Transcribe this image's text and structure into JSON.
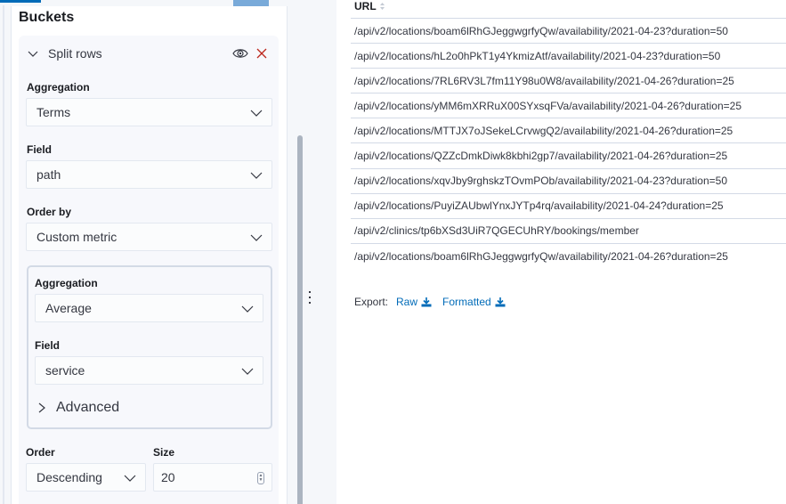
{
  "editor": {
    "section_title": "Buckets",
    "split": {
      "title": "Split rows",
      "toggle_icon": "chevron-down-icon",
      "visibility_icon": "eye-icon",
      "remove_icon": "close-icon"
    },
    "aggregation": {
      "label": "Aggregation",
      "value": "Terms"
    },
    "field": {
      "label": "Field",
      "value": "path"
    },
    "order_by": {
      "label": "Order by",
      "value": "Custom metric"
    },
    "custom_metric": {
      "aggregation": {
        "label": "Aggregation",
        "value": "Average"
      },
      "field": {
        "label": "Field",
        "value": "service"
      },
      "advanced_label": "Advanced"
    },
    "order": {
      "label": "Order",
      "value": "Descending"
    },
    "size": {
      "label": "Size",
      "value": "20"
    }
  },
  "table": {
    "column_header": "URL",
    "rows": [
      "/api/v2/locations/boam6lRhGJeggwgrfyQw/availability/2021-04-23?duration=50",
      "/api/v2/locations/hL2o0hPkT1y4YkmizAtf/availability/2021-04-23?duration=50",
      "/api/v2/locations/7RL6RV3L7fm11Y98u0W8/availability/2021-04-26?duration=25",
      "/api/v2/locations/yMM6mXRRuX00SYxsqFVa/availability/2021-04-26?duration=25",
      "/api/v2/locations/MTTJX7oJSekeLCrvwgQ2/availability/2021-04-26?duration=25",
      "/api/v2/locations/QZZcDmkDiwk8kbhi2gp7/availability/2021-04-26?duration=25",
      "/api/v2/locations/xqvJby9rghskzTOvmPOb/availability/2021-04-23?duration=50",
      "/api/v2/locations/PuyiZAUbwlYnxJYTp4rq/availability/2021-04-24?duration=25",
      "/api/v2/clinics/tp6bXSd3UiR7QGECUhRY/bookings/member",
      "/api/v2/locations/boam6lRhGJeggwgrfyQw/availability/2021-04-26?duration=25"
    ]
  },
  "export": {
    "label": "Export:",
    "raw": "Raw",
    "formatted": "Formatted"
  },
  "colors": {
    "link": "#006bb8",
    "danger": "#bd271e",
    "accent": "#006bb8"
  }
}
